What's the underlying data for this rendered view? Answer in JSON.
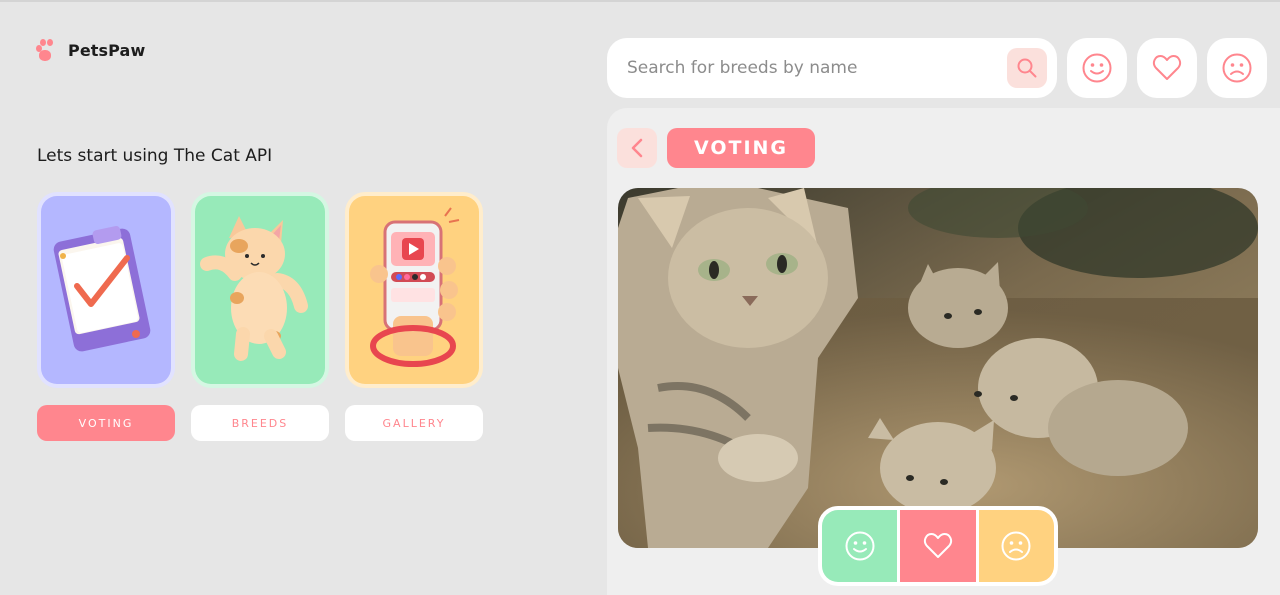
{
  "brand": {
    "name": "PetsPaw",
    "accent": "#ff868e"
  },
  "intro": "Lets start using The Cat API",
  "nav": [
    {
      "label": "VOTING",
      "color": "#b4b7ff",
      "active": true
    },
    {
      "label": "BREEDS",
      "color": "#97eab9",
      "active": false
    },
    {
      "label": "GALLERY",
      "color": "#ffd280",
      "active": false
    }
  ],
  "search": {
    "placeholder": "Search for breeds by name",
    "value": ""
  },
  "top_icons": [
    "smile-icon",
    "heart-icon",
    "sad-icon"
  ],
  "breadcrumb": {
    "current": "VOTING"
  },
  "vote_actions": [
    {
      "icon": "smile-icon",
      "color": "#97eab9"
    },
    {
      "icon": "heart-icon",
      "color": "#ff868e"
    },
    {
      "icon": "sad-icon",
      "color": "#ffd280"
    }
  ]
}
